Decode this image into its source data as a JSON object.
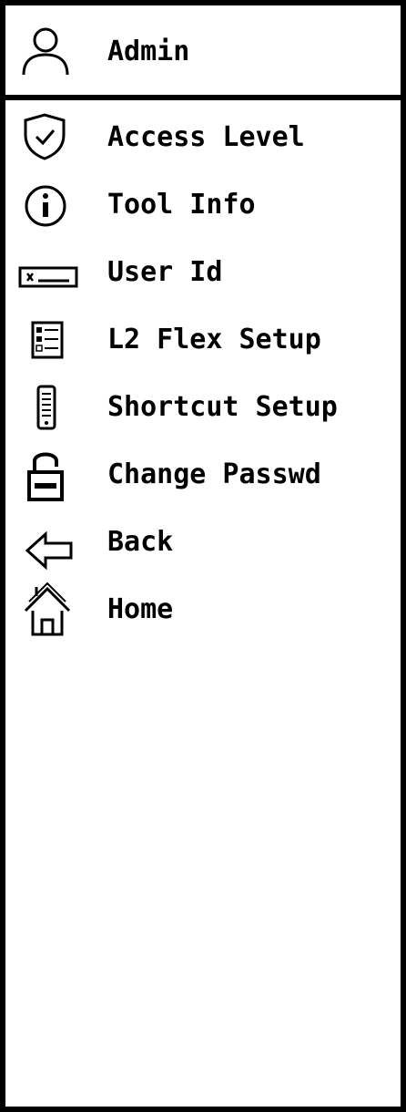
{
  "header": {
    "title": "Admin",
    "icon": "user-icon"
  },
  "menu": {
    "items": [
      {
        "label": "Access Level",
        "icon": "shield-check-icon"
      },
      {
        "label": "Tool Info",
        "icon": "info-icon"
      },
      {
        "label": "User Id",
        "icon": "id-field-icon"
      },
      {
        "label": "L2 Flex Setup",
        "icon": "list-settings-icon"
      },
      {
        "label": "Shortcut Setup",
        "icon": "phone-list-icon"
      },
      {
        "label": "Change Passwd",
        "icon": "unlock-icon"
      },
      {
        "label": "Back",
        "icon": "arrow-left-icon"
      },
      {
        "label": "Home",
        "icon": "home-icon"
      }
    ]
  }
}
